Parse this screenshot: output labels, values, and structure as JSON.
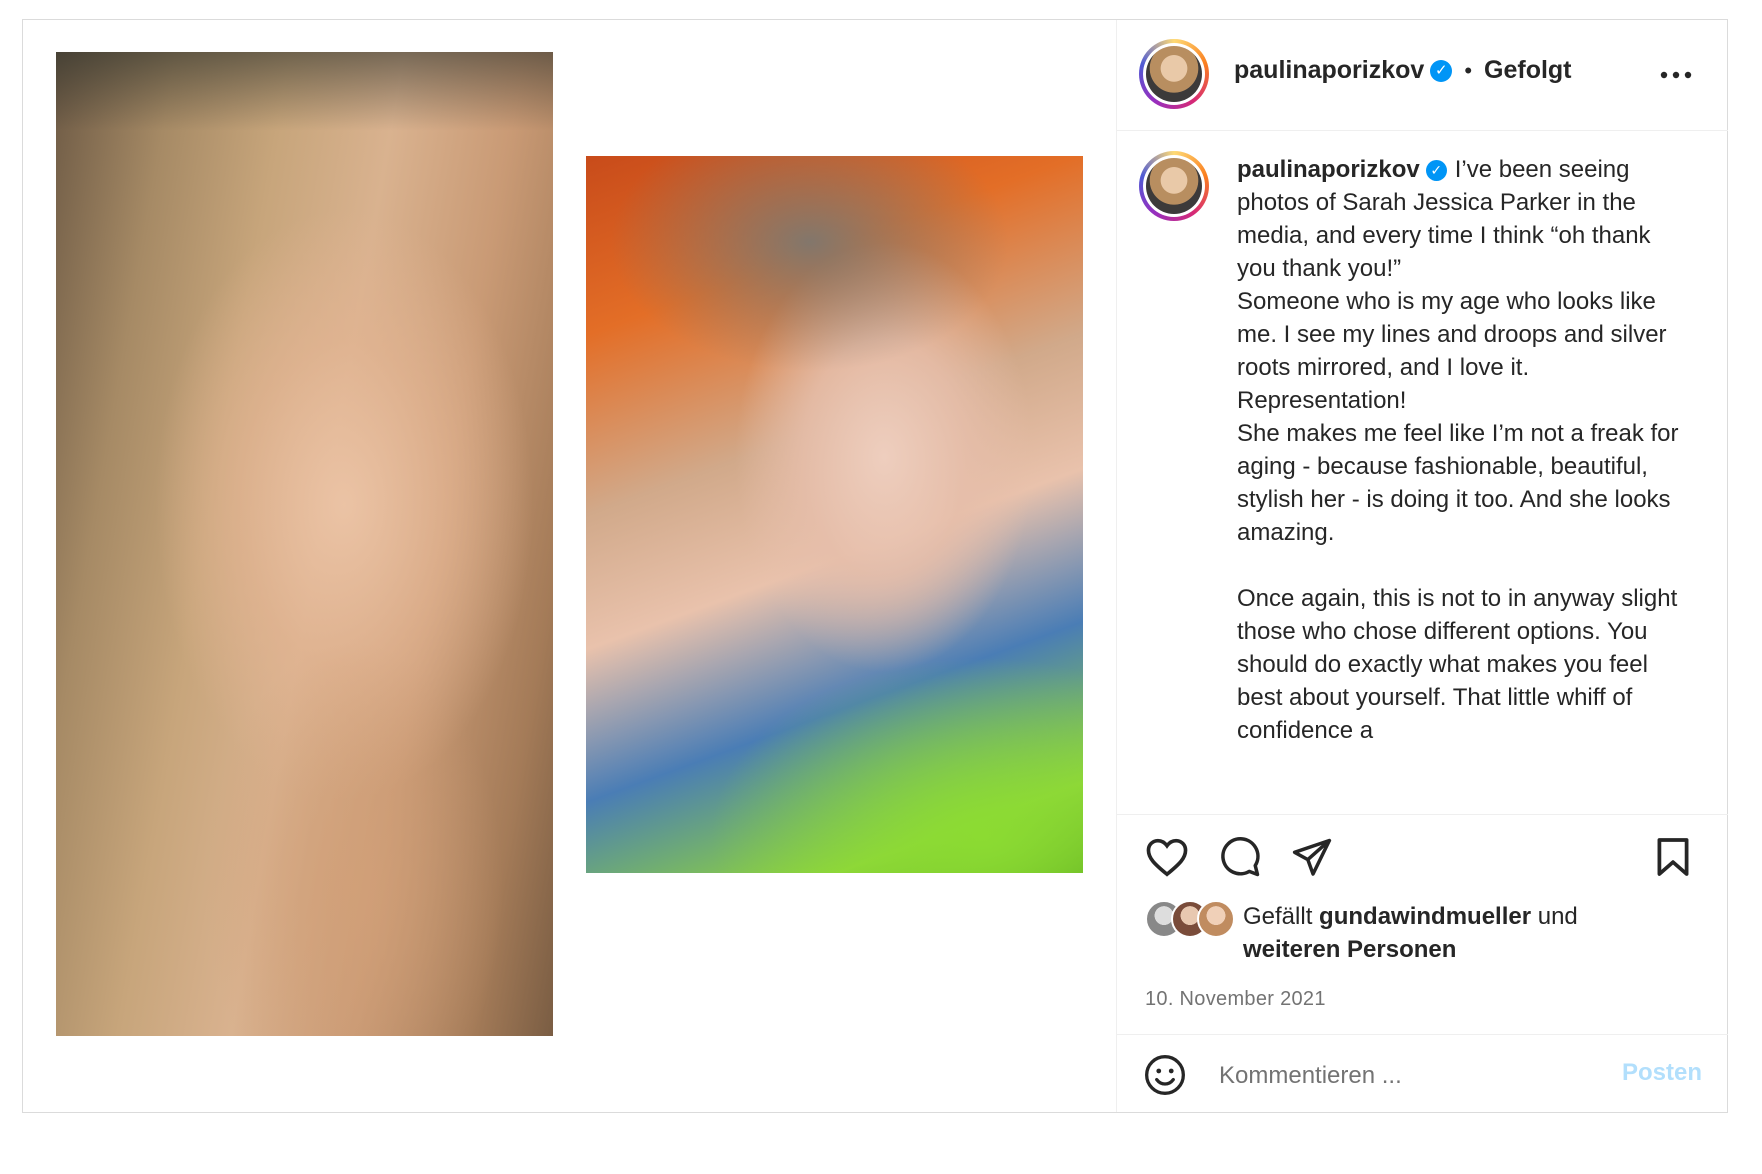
{
  "header": {
    "username": "paulinaporizkov",
    "separator": "•",
    "follow_status": "Gefolgt",
    "more_icon": "more-horizontal-icon"
  },
  "caption": {
    "username": "paulinaporizkov",
    "text": "I’ve been seeing photos of Sarah Jessica Parker in the media, and every time I think “oh thank you thank you!”\nSomeone who is my age who looks like me. I see my lines and droops and silver roots mirrored, and I love it.\nRepresentation!\nShe makes me feel like I’m not a freak for aging - because fashionable, beautiful, stylish her - is doing it too. And she looks amazing.\n\nOnce again, this is not to in anyway slight those who chose different options. You should do exactly what makes you feel best about yourself. That little whiff of confidence a"
  },
  "actions": {
    "like_icon": "heart-icon",
    "comment_icon": "comment-icon",
    "share_icon": "send-icon",
    "save_icon": "bookmark-icon"
  },
  "likes": {
    "prefix": "Gefällt",
    "user": "gundawindmueller",
    "connector": "und",
    "others": "weiteren Personen"
  },
  "date": "10. November 2021",
  "comment": {
    "emoji_icon": "smiley-icon",
    "placeholder": "Kommentieren ...",
    "post_label": "Posten"
  },
  "colors": {
    "accent": "#0095f6",
    "post_disabled": "#b2dffc",
    "text": "#262626",
    "secondary": "#737373"
  }
}
